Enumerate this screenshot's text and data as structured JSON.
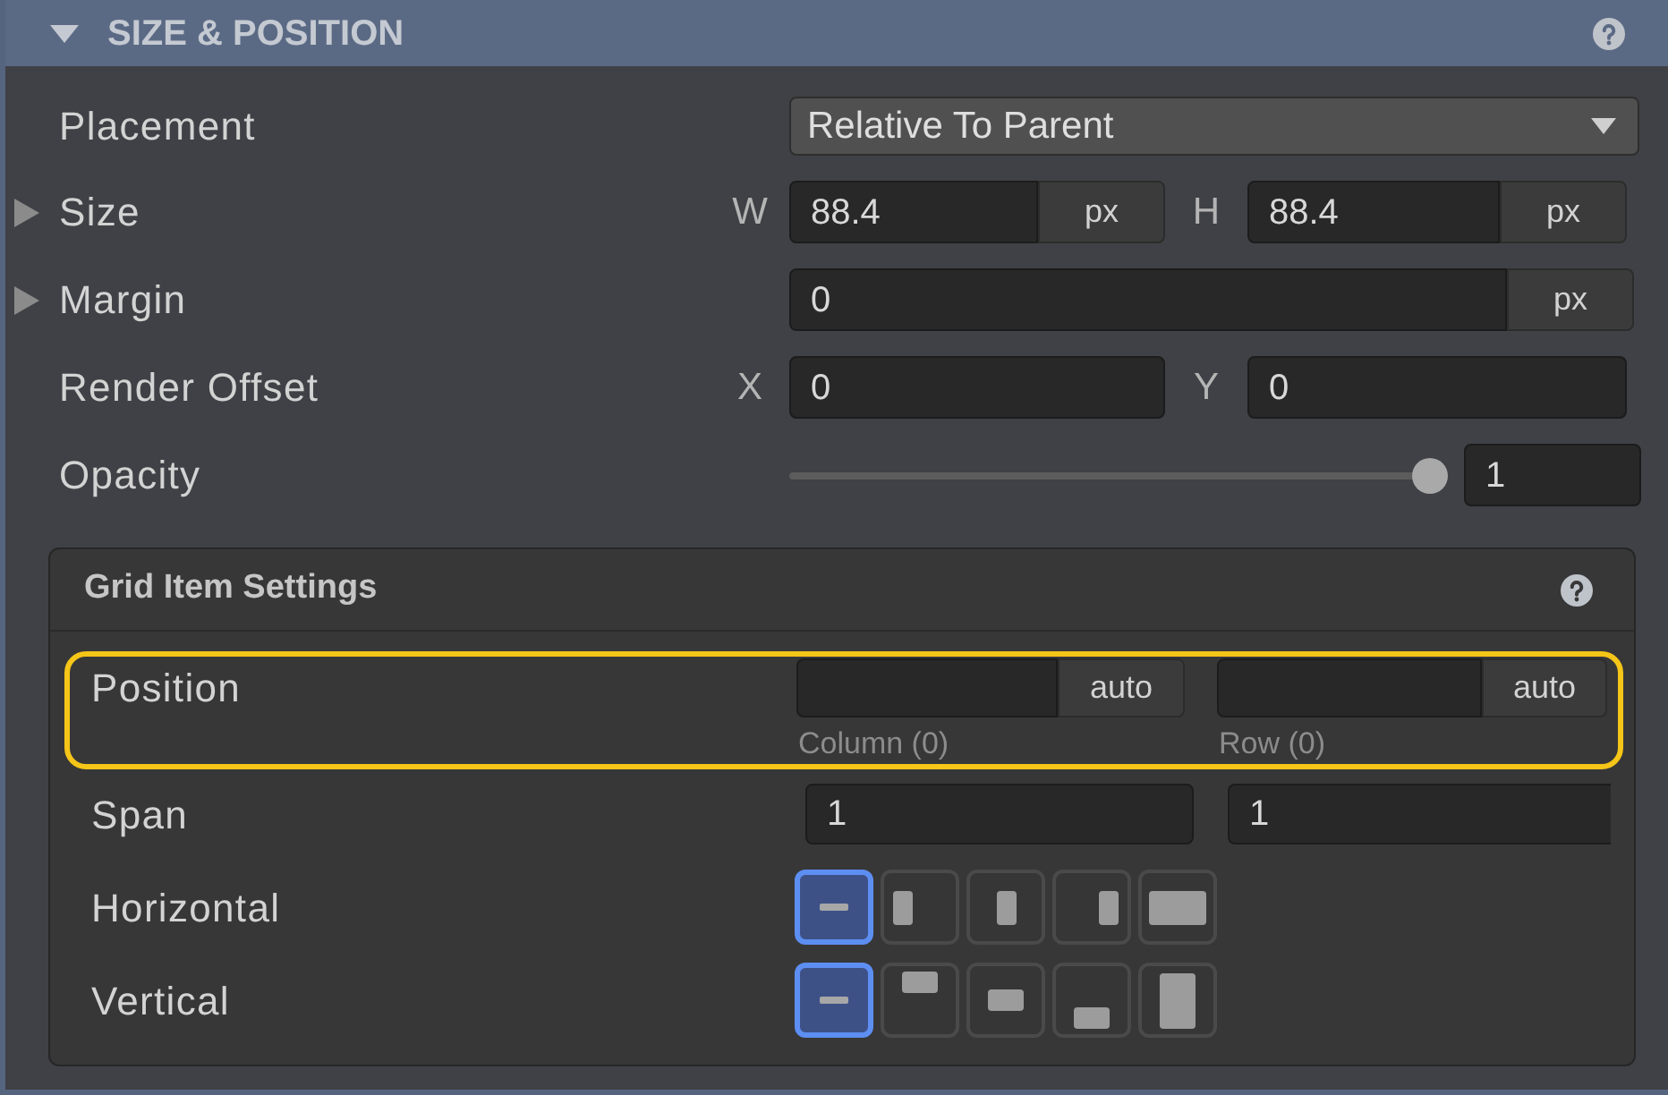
{
  "section": {
    "title": "SIZE & POSITION",
    "expanded": true
  },
  "rows": [
    {
      "kind": "dropdown",
      "label": "Placement",
      "value": "Relative To Parent"
    },
    {
      "kind": "unitpair",
      "label": "Size",
      "expanded": false,
      "fields": [
        {
          "axis": "W",
          "value": "88.4",
          "unit": "px"
        },
        {
          "axis": "H",
          "value": "88.4",
          "unit": "px"
        }
      ]
    },
    {
      "kind": "unitfield",
      "label": "Margin",
      "expanded": false,
      "value": "0",
      "unit": "px"
    },
    {
      "kind": "pair",
      "label": "Render Offset",
      "fields": [
        {
          "axis": "X",
          "value": "0"
        },
        {
          "axis": "Y",
          "value": "0"
        }
      ]
    },
    {
      "kind": "slider",
      "label": "Opacity",
      "level": 1,
      "value": "1"
    }
  ],
  "grid_item_settings": {
    "title": "Grid Item Settings",
    "rows": [
      {
        "kind": "position",
        "label": "Position",
        "highlighted": true,
        "fields": [
          {
            "unit": "auto",
            "caption": "Column (0)"
          },
          {
            "unit": "auto",
            "caption": "Row (0)"
          }
        ]
      },
      {
        "kind": "span",
        "label": "Span",
        "fields": [
          {
            "value": "1"
          },
          {
            "value": "1"
          }
        ]
      },
      {
        "kind": "halign",
        "label": "Horizontal",
        "options": [
          {
            "kind": "auto",
            "selected": true
          },
          {
            "kind": "start",
            "selected": false
          },
          {
            "kind": "center",
            "selected": false
          },
          {
            "kind": "end",
            "selected": false
          },
          {
            "kind": "stretch",
            "selected": false
          }
        ]
      },
      {
        "kind": "valign",
        "label": "Vertical",
        "options": [
          {
            "kind": "auto",
            "selected": true
          },
          {
            "kind": "start",
            "selected": false
          },
          {
            "kind": "center",
            "selected": false
          },
          {
            "kind": "end",
            "selected": false
          },
          {
            "kind": "stretch",
            "selected": false
          }
        ]
      }
    ]
  }
}
